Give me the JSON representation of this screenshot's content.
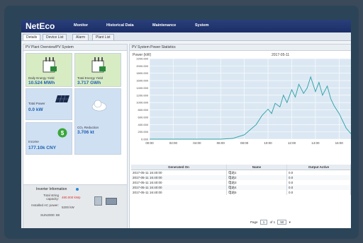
{
  "app": {
    "logo": "NetEco"
  },
  "nav": [
    "Monitor",
    "Historical Data",
    "Maintenance",
    "System"
  ],
  "tabs": [
    "Details",
    "Device List",
    "Alarm",
    "Plant List"
  ],
  "left": {
    "title": "PV Plant Overview/PV System",
    "cards": {
      "daily": {
        "label": "Daily Energy Yield",
        "value": "10.524 MWh"
      },
      "total": {
        "label": "Total Energy Yield",
        "value": "3.717 GWh"
      },
      "power": {
        "label": "Total Power",
        "value": "0.0 kW"
      },
      "co2": {
        "label": "CO₂ Reduction",
        "value": "3.706 kt"
      },
      "income": {
        "label": "Income",
        "value": "177.10k CNY"
      }
    },
    "inverter": {
      "title": "Inverter Information",
      "string_label": "Total string capacity:",
      "string_value": "480.000 kWp",
      "installed_label": "Installed AC power:",
      "installed_value": "5200 kW",
      "sun_label": "SUN2000: 88"
    }
  },
  "right": {
    "title": "PV System Power Statistics",
    "ylabel": "Power (kW)",
    "date": "2017-05-11",
    "columns": [
      "Generated On",
      "Name",
      "Output Active"
    ],
    "rows": [
      [
        "2017-05-11 16:40:00",
        "电站1",
        "0.0"
      ],
      [
        "2017-05-11 16:40:00",
        "电站2",
        "0.0"
      ],
      [
        "2017-05-11 16:40:00",
        "电站3",
        "0.0"
      ],
      [
        "2017-05-11 16:40:00",
        "电站4",
        "0.0"
      ],
      [
        "2017-05-11 16:40:00",
        "电站5",
        "0.0"
      ]
    ],
    "pager": {
      "label": "Page",
      "page": "1",
      "of": "of 1",
      "size": "50"
    }
  },
  "chart_data": {
    "type": "line",
    "ylabel": "Power (kW)",
    "title": "2017-05-11",
    "ylim": [
      0,
      2200
    ],
    "yticks": [
      "2200.000",
      "2000.000",
      "1800.000",
      "1600.000",
      "1400.000",
      "1200.000",
      "1000.000",
      "800.000",
      "600.000",
      "400.000",
      "200.000",
      "0.000"
    ],
    "xticks": [
      "00:00",
      "02:00",
      "04:00",
      "06:00",
      "08:00",
      "10:00",
      "12:00",
      "14:00",
      "16:00"
    ],
    "x_hours": [
      0,
      1,
      2,
      3,
      4,
      5,
      6,
      7,
      8,
      9,
      9.5,
      10,
      10.3,
      10.6,
      11,
      11.3,
      11.6,
      12,
      12.3,
      12.6,
      13,
      13.3,
      13.6,
      14,
      14.3,
      14.6,
      15,
      15.3,
      15.6,
      16,
      16.3,
      16.6,
      17
    ],
    "y": [
      0,
      0,
      0,
      0,
      0,
      0,
      0,
      20,
      120,
      400,
      650,
      820,
      700,
      980,
      880,
      1200,
      1000,
      1350,
      1150,
      1500,
      1250,
      1400,
      1700,
      1300,
      1550,
      1200,
      1450,
      1100,
      900,
      700,
      500,
      300,
      150
    ]
  },
  "colors": {
    "line": "#2a9fa5",
    "fill": "#dbe8f3",
    "accent": "#1b5fb0",
    "nav": "#1b2e66"
  }
}
